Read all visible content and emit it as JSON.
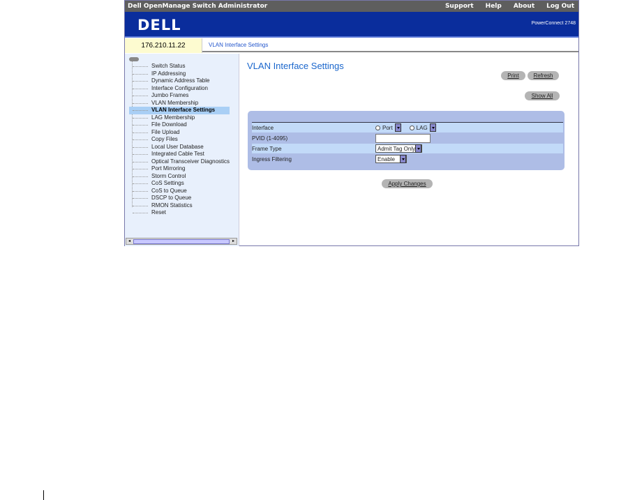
{
  "titlebar": {
    "title": "Dell OpenManage Switch Administrator",
    "links": [
      "Support",
      "Help",
      "About",
      "Log Out"
    ]
  },
  "banner": {
    "logo": "DELL",
    "model": "PowerConnect 2748"
  },
  "ip": "176.210.11.22",
  "breadcrumb": "VLAN Interface Settings",
  "sidebar": {
    "items": [
      "Switch Status",
      "IP Addressing",
      "Dynamic Address Table",
      "Interface Configuration",
      "Jumbo Frames",
      "VLAN Membership",
      "VLAN Interface Settings",
      "LAG Membership",
      "File Download",
      "File Upload",
      "Copy Files",
      "Local User Database",
      "Integrated Cable Test",
      "Optical Transceiver Diagnostics",
      "Port Mirroring",
      "Storm Control",
      "CoS Settings",
      "CoS to Queue",
      "DSCP to Queue",
      "RMON Statistics",
      "Reset"
    ],
    "selected": "VLAN Interface Settings"
  },
  "main": {
    "title": "VLAN Interface Settings",
    "print": "Print",
    "refresh": "Refresh",
    "show_all": "Show All",
    "apply": "Apply Changes",
    "form": {
      "interface_label": "Interface",
      "port": "Port",
      "lag": "LAG",
      "pvid_label": "PVID (1-4095)",
      "pvid_value": "",
      "frame_label": "Frame Type",
      "frame_value": "Admit Tag Only",
      "ingress_label": "Ingress Filtering",
      "ingress_value": "Enable"
    }
  }
}
